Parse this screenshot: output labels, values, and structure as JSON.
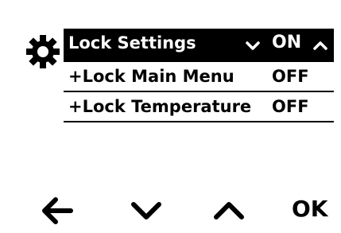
{
  "header": {
    "icon": "gear-icon",
    "label": "Lock Settings",
    "value": "ON",
    "down_icon": "chevron-down-icon",
    "up_icon": "chevron-up-icon"
  },
  "rows": [
    {
      "label": "+Lock Main Menu",
      "value": "OFF"
    },
    {
      "label": "+Lock Temperature",
      "value": "OFF"
    }
  ],
  "nav": {
    "back_icon": "arrow-left-icon",
    "down_icon": "chevron-down-icon",
    "up_icon": "chevron-up-icon",
    "ok_label": "OK"
  },
  "colors": {
    "background": "#ffffff",
    "foreground": "#000000"
  }
}
